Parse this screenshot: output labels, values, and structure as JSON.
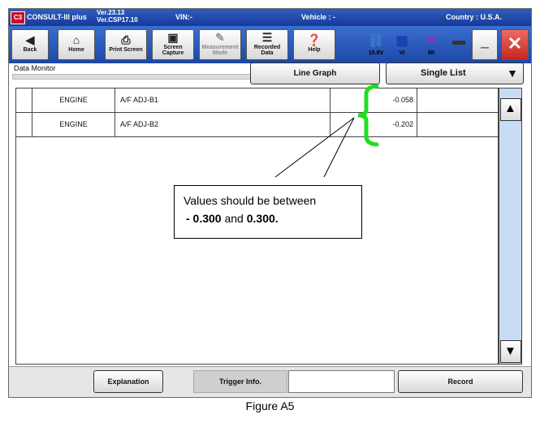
{
  "titlebar": {
    "app": "CONSULT-III plus",
    "version_line1": "Ver.23.13",
    "version_line2": "Ver.CSP17.10",
    "vin_label": "VIN:-",
    "vehicle_label": "Vehicle : -",
    "country_label": "Country : U.S.A."
  },
  "toolbar": {
    "back": "Back",
    "home": "Home",
    "print_screen": "Print Screen",
    "screen_capture_1": "Screen",
    "screen_capture_2": "Capture",
    "measurement_1": "Measurement",
    "measurement_2": "Mode",
    "recorded_1": "Recorded",
    "recorded_2": "Data",
    "help": "Help",
    "battery": "15.9V",
    "vi": "VI",
    "mi": "MI"
  },
  "header": {
    "data_monitor": "Data Monitor",
    "line_graph": "Line Graph",
    "single_list": "Single List"
  },
  "rows": [
    {
      "system": "ENGINE",
      "item": "A/F ADJ-B1",
      "value": "-0.058"
    },
    {
      "system": "ENGINE",
      "item": "A/F ADJ-B2",
      "value": "-0.202"
    }
  ],
  "callout": {
    "line1": "Values should be between",
    "low": "- 0.300",
    "and": " and ",
    "high": "0.300."
  },
  "bottom": {
    "explanation": "Explanation",
    "trigger_info": "Trigger Info.",
    "record": "Record"
  },
  "caption": "Figure A5",
  "colors": {
    "titlebar": "#2f5fbd",
    "bracket": "#22dd22",
    "scrollbar": "#c9dcf6",
    "close": "#d9342b"
  }
}
